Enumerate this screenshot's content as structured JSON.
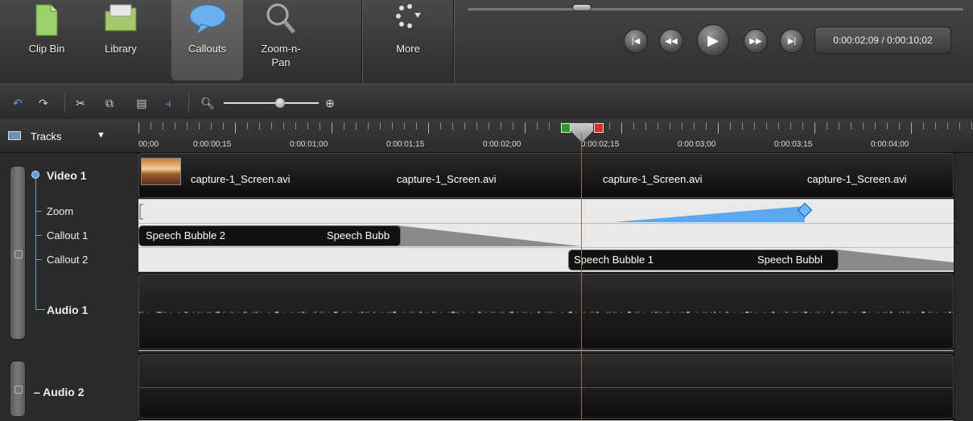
{
  "tasks": {
    "clip_bin": "Clip Bin",
    "library": "Library",
    "callouts": "Callouts",
    "zoom_pan_line1": "Zoom-n-",
    "zoom_pan_line2": "Pan",
    "more": "More"
  },
  "player": {
    "timecode": "0:00:02;09 / 0:00:10;02",
    "position_fraction": 0.23
  },
  "tracks_menu": {
    "label": "Tracks"
  },
  "track_headers": {
    "video1": "Video 1",
    "zoom": "Zoom",
    "callout1": "Callout 1",
    "callout2": "Callout 2",
    "audio1": "Audio 1",
    "audio2": "Audio 2"
  },
  "ruler": {
    "labels": [
      "00;00",
      "0:00:00;15",
      "0:00:01;00",
      "0:00:01;15",
      "0:00:02;00",
      "0:00:02;15",
      "0:00:03;00",
      "0:00:03;15",
      "0:00:04;00"
    ]
  },
  "video_clips": {
    "labels": [
      "capture-1_Screen.avi",
      "capture-1_Screen.avi",
      "capture-1_Screen.avi",
      "capture-1_Screen.avi"
    ]
  },
  "callout_clips": {
    "callout1_a": "Speech Bubble 2",
    "callout1_b": "Speech Bubb",
    "callout2_a": "Speech Bubble 1",
    "callout2_b": "Speech Bubbl"
  },
  "colors": {
    "playhead": "#3b7fd8",
    "zoom_ramp": "#5aa8f0",
    "mark_in": "#2e9a2e",
    "mark_out": "#d03030"
  }
}
